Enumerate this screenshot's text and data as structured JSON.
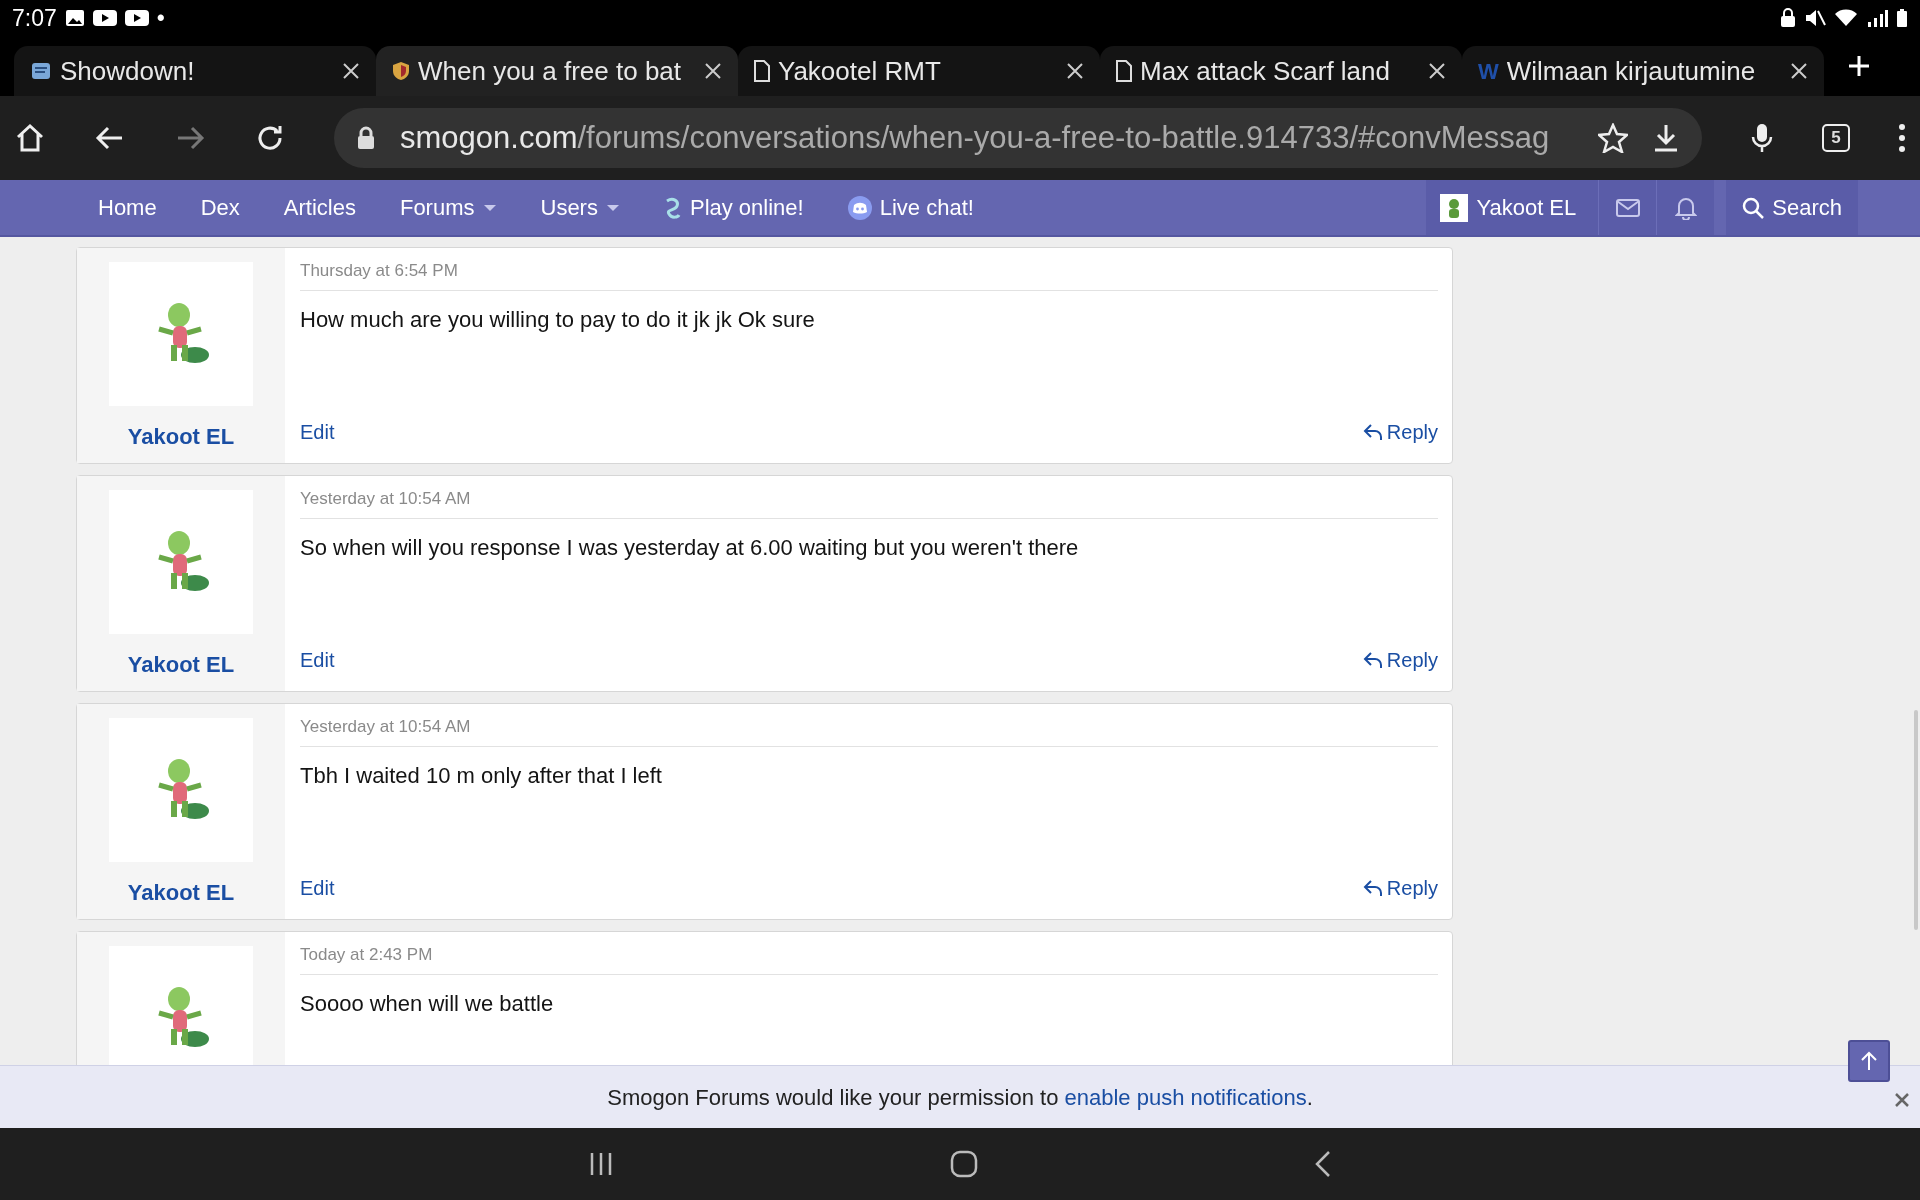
{
  "status_bar": {
    "time": "7:07",
    "indicator": "•"
  },
  "tabs": [
    {
      "title": "Showdown!",
      "selected": false,
      "kind": "site"
    },
    {
      "title": "When you a free to bat",
      "selected": true,
      "kind": "shield"
    },
    {
      "title": "Yakootel RMT",
      "selected": false,
      "kind": "page"
    },
    {
      "title": "Max attack Scarf land",
      "selected": false,
      "kind": "page"
    },
    {
      "title": "Wilmaan kirjautumine",
      "selected": false,
      "kind": "letter",
      "icon_text": "W"
    }
  ],
  "toolbar": {
    "url_host": "smogon.com",
    "url_path": "/forums/conversations/when-you-a-free-to-battle.914733/#convMessag",
    "tab_count": "5"
  },
  "nav": {
    "items": [
      {
        "label": "Home",
        "dropdown": false
      },
      {
        "label": "Dex",
        "dropdown": false
      },
      {
        "label": "Articles",
        "dropdown": false
      },
      {
        "label": "Forums",
        "dropdown": true
      },
      {
        "label": "Users",
        "dropdown": true
      },
      {
        "label": "Play online!",
        "dropdown": false,
        "kind": "showdown"
      },
      {
        "label": "Live chat!",
        "dropdown": false,
        "kind": "chat"
      }
    ],
    "user": "Yakoot EL",
    "search": "Search"
  },
  "messages": [
    {
      "date": "Thursday at 6:54 PM",
      "text": "How much are you willing to pay to do it jk jk Ok sure",
      "author": "Yakoot EL",
      "edit": "Edit",
      "reply": "Reply"
    },
    {
      "date": "Yesterday at 10:54 AM",
      "text": "So when will you response I was yesterday at 6.00 waiting but you weren't there",
      "author": "Yakoot EL",
      "edit": "Edit",
      "reply": "Reply"
    },
    {
      "date": "Yesterday at 10:54 AM",
      "text": "Tbh I waited 10 m only after that I left",
      "author": "Yakoot EL",
      "edit": "Edit",
      "reply": "Reply"
    },
    {
      "date": "Today at 2:43 PM",
      "text": "Soooo when will we battle"
    }
  ],
  "banner": {
    "text": "Smogon Forums would like your permission to ",
    "link": "enable push notifications",
    "suffix": "."
  }
}
